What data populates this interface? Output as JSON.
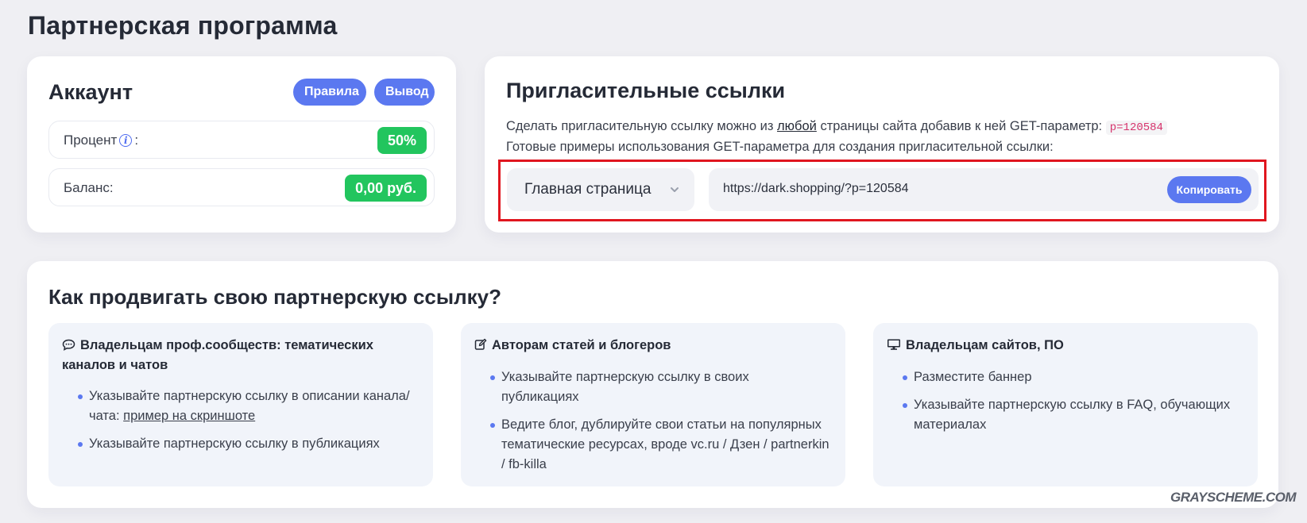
{
  "page": {
    "title": "Партнерская программа"
  },
  "account": {
    "title": "Аккаунт",
    "rules_label": "Правила",
    "withdraw_label": "Вывод",
    "percent_label": "Процент",
    "percent_suffix": ":",
    "percent_value": "50%",
    "balance_label": "Баланс:",
    "balance_value": "0,00 руб."
  },
  "links": {
    "title": "Пригласительные ссылки",
    "desc_before": "Сделать пригласительную ссылку можно из ",
    "desc_link": "любой",
    "desc_after": " страницы сайта добавив к ней GET-параметр: ",
    "param": "p=120584",
    "desc_line2": "Готовые примеры использования GET-параметра для создания пригласительной ссылки:",
    "select_value": "Главная страница",
    "url_value": "https://dark.shopping/?p=120584",
    "copy_label": "Копировать"
  },
  "promo": {
    "title": "Как продвигать свою партнерскую ссылку?",
    "columns": [
      {
        "icon": "chat-bubble-icon",
        "heading": "Владельцам проф.сообществ: тематических каналов и чатов",
        "items": [
          {
            "text": "Указывайте партнерскую ссылку в описании канала/чата: ",
            "link": "пример на скриншоте"
          },
          {
            "text": "Указывайте партнерскую ссылку в публикациях"
          }
        ]
      },
      {
        "icon": "edit-icon",
        "heading": "Авторам статей и блогеров",
        "items": [
          {
            "text": "Указывайте партнерскую ссылку в своих публикациях"
          },
          {
            "text": "Ведите блог, дублируйте свои статьи на популярных тематические ресурсах, вроде vc.ru / Дзен / partnerkin / fb-killa"
          }
        ]
      },
      {
        "icon": "monitor-icon",
        "heading": "Владельцам сайтов, ПО",
        "items": [
          {
            "text": "Разместите баннер"
          },
          {
            "text": "Указывайте партнерскую ссылку в FAQ, обучающих материалах"
          }
        ]
      }
    ]
  },
  "watermark": "GRAYSCHEME.COM",
  "colors": {
    "accent": "#5b78f0",
    "success": "#22c55e",
    "highlight": "#e0161f",
    "code": "#d6336c"
  }
}
